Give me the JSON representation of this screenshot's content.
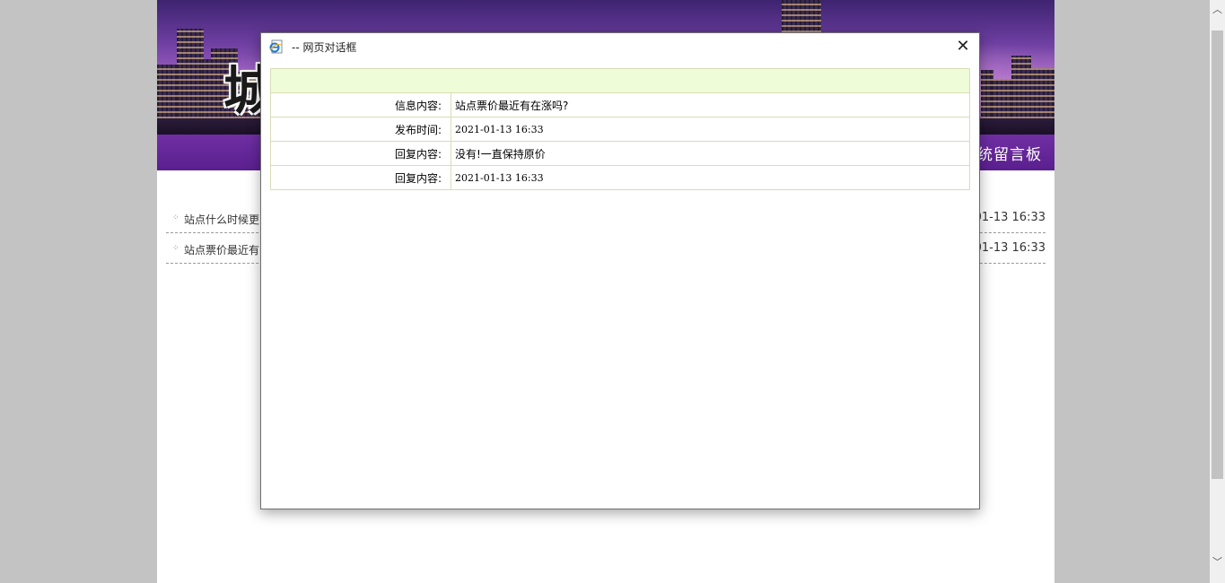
{
  "banner": {
    "title_char": "城"
  },
  "navbar": {
    "title": "统留言板"
  },
  "messages": [
    {
      "subject": "站点什么时候更",
      "time": "01-13 16:33"
    },
    {
      "subject": "站点票价最近有",
      "time": "01-13 16:33"
    }
  ],
  "dialog": {
    "title": "-- 网页对话框",
    "icon": "ie-page-icon",
    "close_icon": "close-icon",
    "close_label": "✕",
    "rows": [
      {
        "label": "信息内容:",
        "value": "站点票价最近有在涨吗?"
      },
      {
        "label": "发布时间:",
        "value": "2021-01-13 16:33"
      },
      {
        "label": "回复内容:",
        "value": "没有!一直保持原价"
      },
      {
        "label": "回复内容:",
        "value": "2021-01-13 16:33"
      }
    ]
  },
  "scrollbar": {
    "up_glyph": "︿",
    "down_glyph": "﹀"
  },
  "colors": {
    "nav_purple": "#5a1f8e",
    "table_header_bg": "#eefcd8",
    "table_border": "#d8dcb8"
  }
}
